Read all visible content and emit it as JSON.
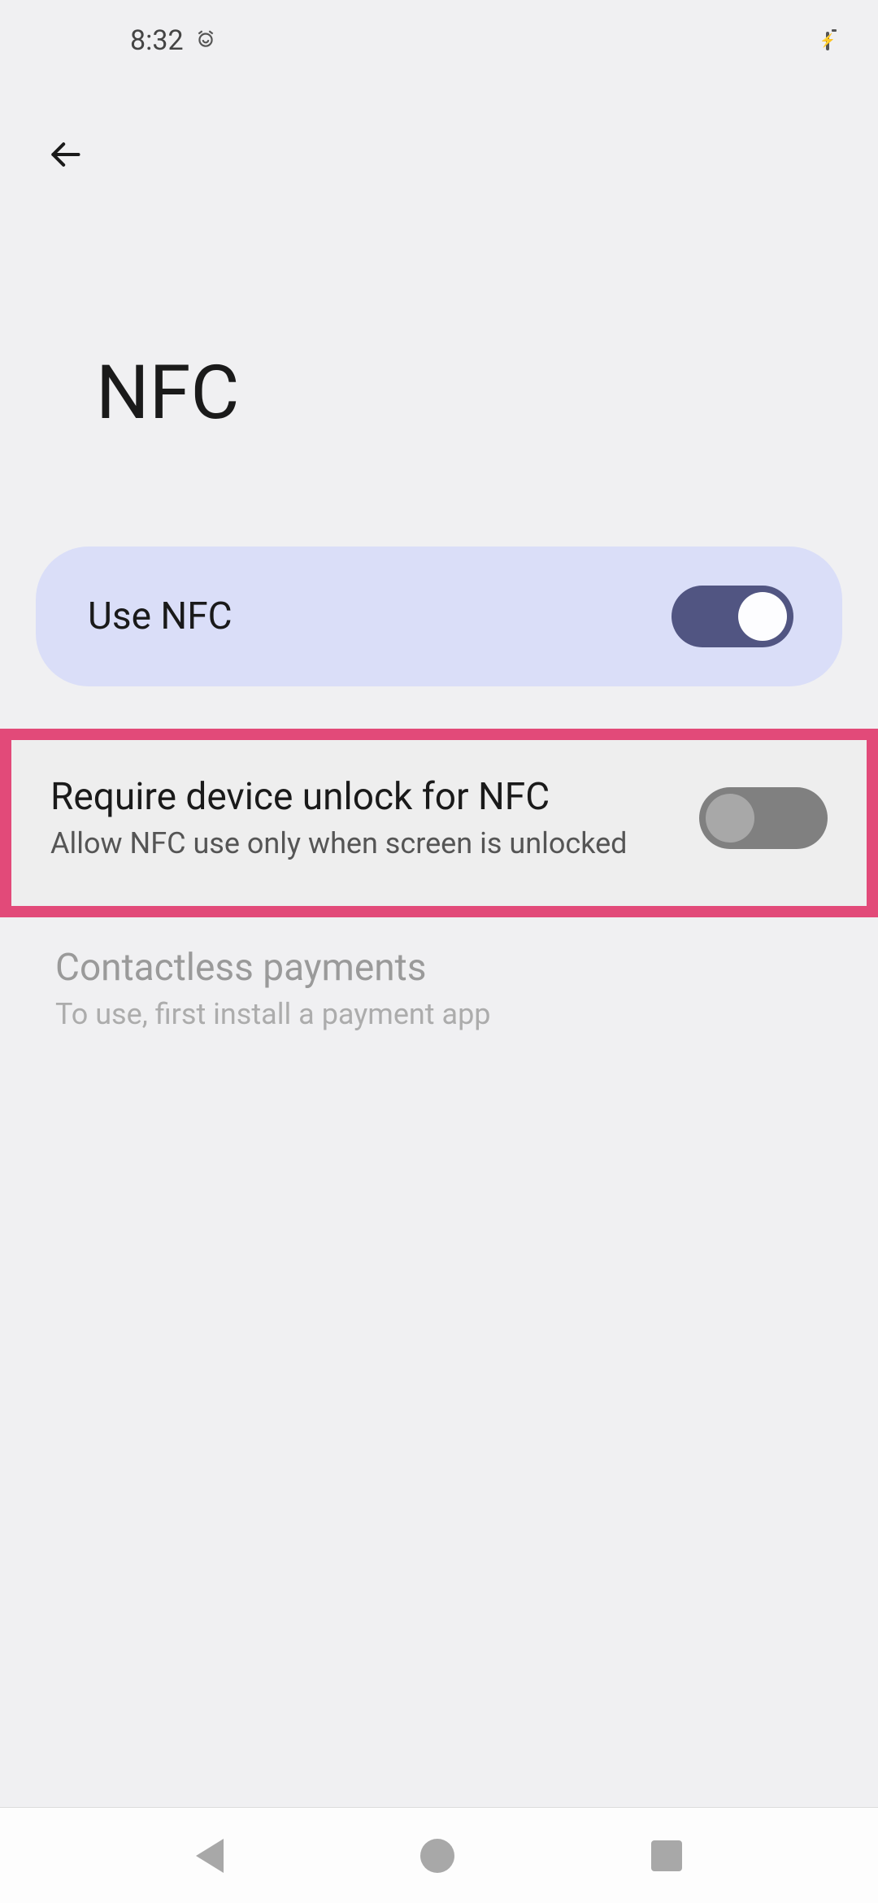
{
  "status": {
    "time": "8:32"
  },
  "page": {
    "title": "NFC"
  },
  "settings": {
    "use_nfc": {
      "label": "Use NFC",
      "enabled": true
    },
    "require_unlock": {
      "title": "Require device unlock for NFC",
      "subtitle": "Allow NFC use only when screen is unlocked",
      "enabled": false
    },
    "contactless": {
      "title": "Contactless payments",
      "subtitle": "To use, first install a payment app",
      "disabled": true
    }
  }
}
